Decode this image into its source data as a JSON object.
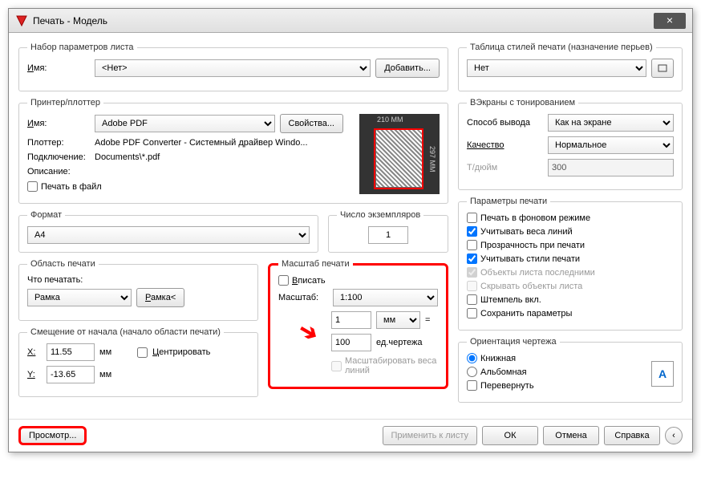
{
  "window": {
    "title": "Печать - Модель"
  },
  "pageSetup": {
    "legend": "Набор параметров листа",
    "nameLabel": "Имя:",
    "nameValue": "<Нет>",
    "addBtn": "Добавить..."
  },
  "printer": {
    "legend": "Принтер/плоттер",
    "nameLabel": "Имя:",
    "nameValue": "Adobe PDF",
    "propsBtn": "Свойства...",
    "plotterLabel": "Плоттер:",
    "plotterValue": "Adobe PDF Converter - Системный драйвер Windo...",
    "connLabel": "Подключение:",
    "connValue": "Documents\\*.pdf",
    "descLabel": "Описание:",
    "printToFile": "Печать в файл",
    "paperW": "210 MM",
    "paperH": "297 MM"
  },
  "paperSize": {
    "legend": "Формат",
    "value": "A4"
  },
  "copies": {
    "legend": "Число экземпляров",
    "value": "1"
  },
  "plotArea": {
    "legend": "Область печати",
    "whatLabel": "Что печатать:",
    "value": "Рамка",
    "windowBtn": "Рамка<"
  },
  "scale": {
    "legend": "Масштаб печати",
    "fitLabel": "Вписать",
    "scaleLabel": "Масштаб:",
    "scaleValue": "1:100",
    "unitValue": "1",
    "unitType": "мм",
    "equals": "=",
    "drawingValue": "100",
    "drawingLabel": "ед.чертежа",
    "scaleLineweights": "Масштабировать веса линий"
  },
  "offset": {
    "legend": "Смещение от начала (начало области печати)",
    "xLabel": "X:",
    "xValue": "11.55",
    "xUnit": "мм",
    "yLabel": "Y:",
    "yValue": "-13.65",
    "yUnit": "мм",
    "centerLabel": "Центрировать"
  },
  "plotStyle": {
    "legend": "Таблица стилей печати (назначение перьев)",
    "value": "Нет"
  },
  "shaded": {
    "legend": "ВЭкраны с тонированием",
    "modeLabel": "Способ вывода",
    "modeValue": "Как на экране",
    "qualityLabel": "Качество",
    "qualityValue": "Нормальное",
    "dpiLabel": "Т/дюйм",
    "dpiValue": "300"
  },
  "options": {
    "legend": "Параметры печати",
    "background": "Печать в фоновом режиме",
    "lineweights": "Учитывать веса линий",
    "transparency": "Прозрачность при печати",
    "plotstyles": "Учитывать стили печати",
    "paperspace": "Объекты листа последними",
    "hide": "Скрывать объекты листа",
    "stamp": "Штемпель вкл.",
    "save": "Сохранить параметры"
  },
  "orientation": {
    "legend": "Ориентация чертежа",
    "portrait": "Книжная",
    "landscape": "Альбомная",
    "upside": "Перевернуть"
  },
  "footer": {
    "preview": "Просмотр...",
    "apply": "Применить к листу",
    "ok": "ОК",
    "cancel": "Отмена",
    "help": "Справка"
  }
}
